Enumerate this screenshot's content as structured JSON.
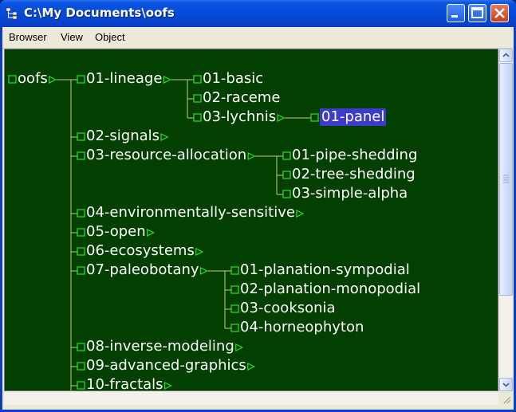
{
  "window": {
    "title": "C:\\My Documents\\oofs"
  },
  "menu": {
    "items": [
      "Browser",
      "View",
      "Object"
    ]
  },
  "tree": {
    "nodes": [
      {
        "label": "oofs",
        "expander": true
      },
      {
        "label": "01-lineage",
        "expander": true
      },
      {
        "label": "01-basic",
        "expander": false
      },
      {
        "label": "02-raceme",
        "expander": false
      },
      {
        "label": "03-lychnis",
        "expander": true
      },
      {
        "label": "01-panel",
        "expander": false,
        "selected": true
      },
      {
        "label": "02-signals",
        "expander": true
      },
      {
        "label": "03-resource-allocation",
        "expander": true
      },
      {
        "label": "01-pipe-shedding",
        "expander": false
      },
      {
        "label": "02-tree-shedding",
        "expander": false
      },
      {
        "label": "03-simple-alpha",
        "expander": false
      },
      {
        "label": "04-environmentally-sensitive",
        "expander": true
      },
      {
        "label": "05-open",
        "expander": true
      },
      {
        "label": "06-ecosystems",
        "expander": true
      },
      {
        "label": "07-paleobotany",
        "expander": true
      },
      {
        "label": "01-planation-sympodial",
        "expander": false
      },
      {
        "label": "02-planation-monopodial",
        "expander": false
      },
      {
        "label": "03-cooksonia",
        "expander": false
      },
      {
        "label": "04-horneophyton",
        "expander": false
      },
      {
        "label": "08-inverse-modeling",
        "expander": true
      },
      {
        "label": "09-advanced-graphics",
        "expander": true
      },
      {
        "label": "10-fractals",
        "expander": true
      }
    ]
  },
  "colors": {
    "background": "#023f00",
    "line": "#c8c87a",
    "box": "#28e028",
    "selection": "#3c3cc8",
    "text": "#ffffff"
  }
}
